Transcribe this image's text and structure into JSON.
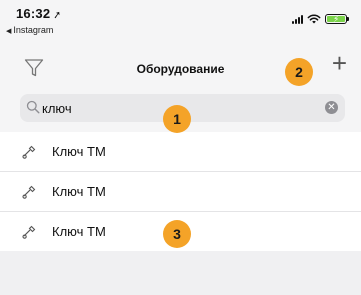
{
  "status_bar": {
    "time": "16:32",
    "location_arrow": "➚",
    "back_label": "Instagram",
    "back_arrow": "◀",
    "battery_color": "#7bd34a"
  },
  "navbar": {
    "title": "Оборудование",
    "plus_symbol": "+",
    "filter_icon": "funnel-icon"
  },
  "search": {
    "value": "ключ",
    "clear_symbol": "✕"
  },
  "list": {
    "items": [
      {
        "label": "Ключ ТМ",
        "icon": "key-icon"
      },
      {
        "label": "Ключ ТМ",
        "icon": "key-icon"
      },
      {
        "label": "Ключ ТМ",
        "icon": "key-icon"
      }
    ]
  },
  "annotations": {
    "badge_color": "#f4a328",
    "badge_1": "1",
    "badge_2": "2",
    "badge_3": "3"
  }
}
